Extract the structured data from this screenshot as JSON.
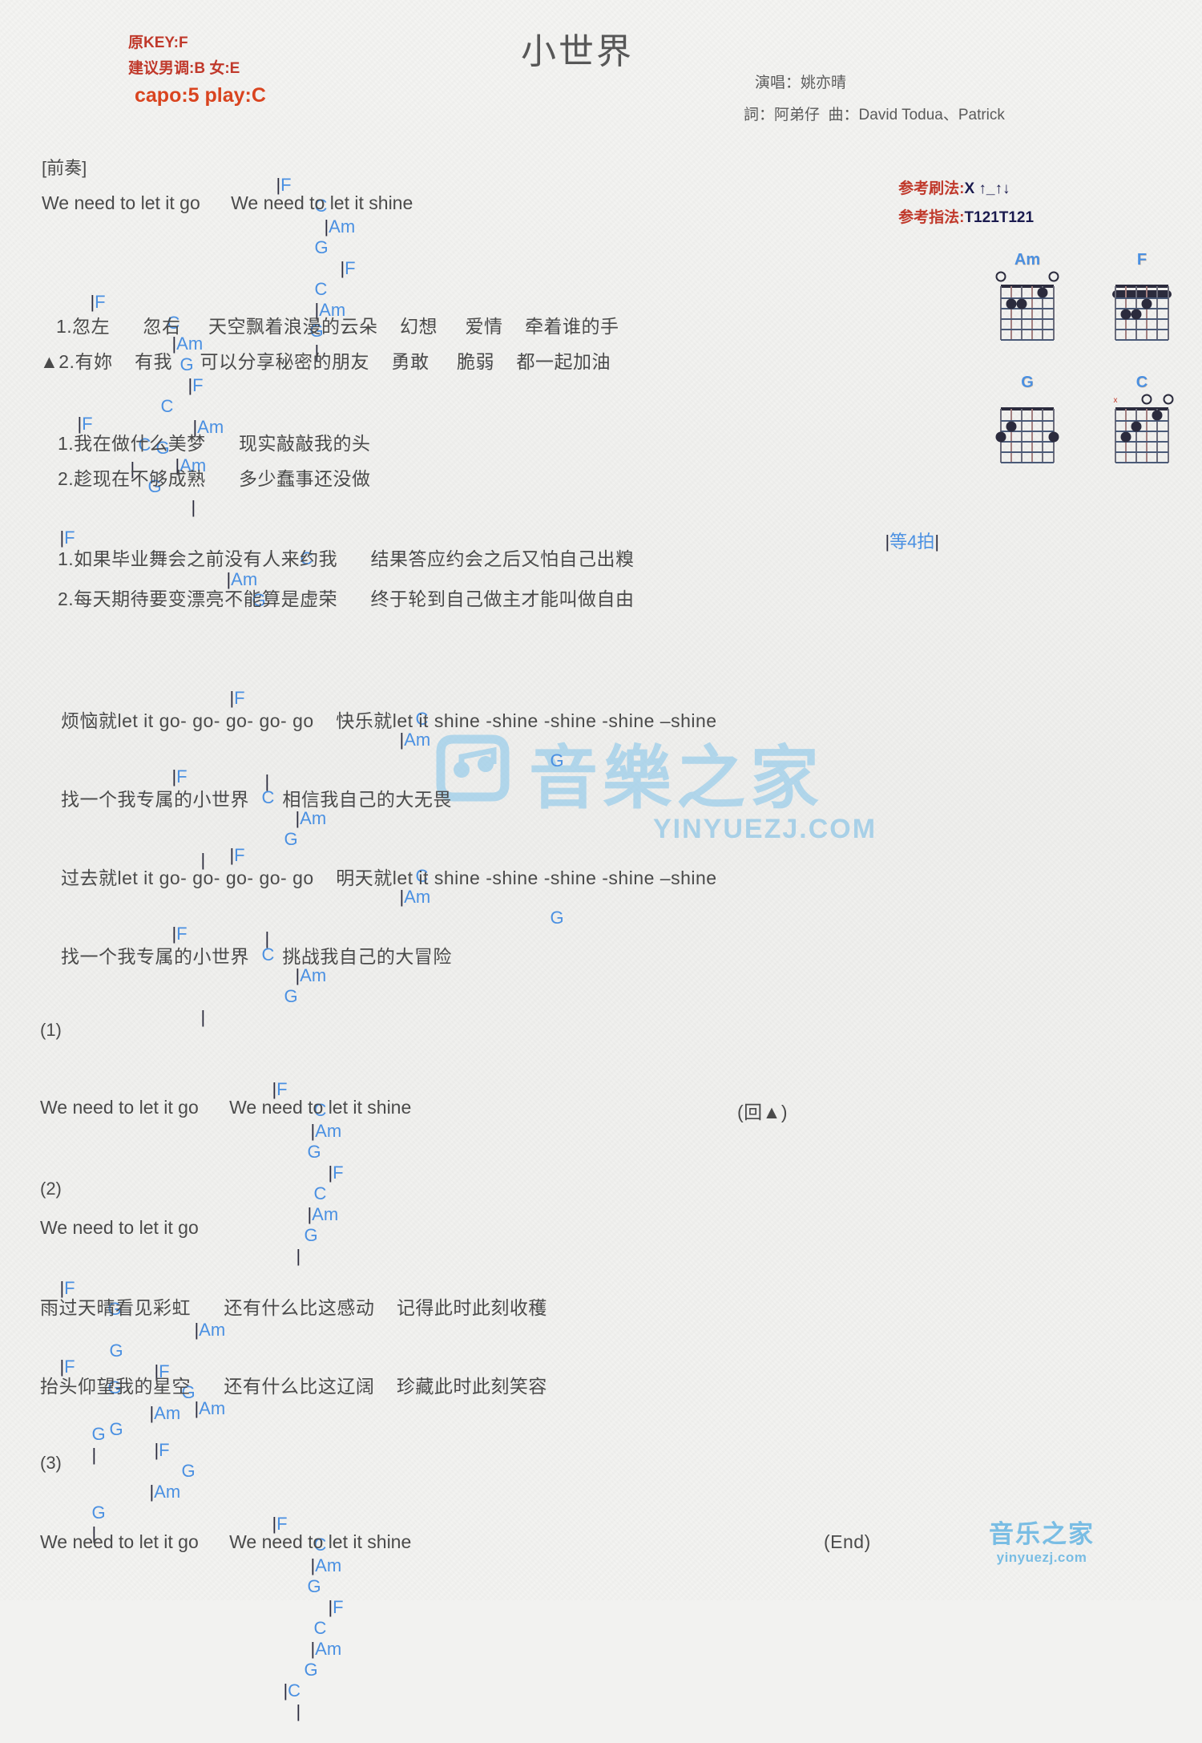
{
  "header": {
    "orig_key": "原KEY:F",
    "suggest_key": "建议男调:B 女:E",
    "capo": "capo:5 play:C",
    "title": "小世界",
    "singer": "演唱：姚亦晴",
    "writers": "詞：阿弟仔  曲：David Todua、Patrick",
    "strum_label": "参考刷法:",
    "strum_value": "X ↑_↑↓",
    "finger_label": "参考指法:",
    "finger_value": "T121T121"
  },
  "chord_diagrams": [
    {
      "name": "Am",
      "markers": [
        "o",
        "",
        "",
        "",
        "",
        "o"
      ],
      "dots": [
        [
          4,
          2
        ],
        [
          3,
          1
        ],
        [
          2,
          1
        ]
      ],
      "barre": null,
      "muted": []
    },
    {
      "name": "F",
      "markers": [
        "",
        "",
        "",
        "",
        "",
        ""
      ],
      "dots": [
        [
          4,
          2
        ],
        [
          3,
          2
        ],
        [
          2,
          1
        ]
      ],
      "barre": 1,
      "muted": []
    },
    {
      "name": "G",
      "markers": [
        "",
        "",
        "",
        "",
        "",
        ""
      ],
      "dots": [
        [
          5,
          2
        ],
        [
          1,
          3
        ],
        [
          6,
          3
        ]
      ],
      "barre": null,
      "muted": []
    },
    {
      "name": "C",
      "markers": [
        "x",
        "",
        "",
        "o",
        "",
        "o"
      ],
      "dots": [
        [
          5,
          3
        ],
        [
          4,
          2
        ],
        [
          2,
          1
        ]
      ],
      "barre": null,
      "muted": [
        "x"
      ]
    }
  ],
  "sections": [
    {
      "id": "intro",
      "label": "[前奏]",
      "chord_line": "|F      C        |Am      G            |F      C     |Am      G     |",
      "lyric_lines": [
        "We need to let it go      We need to let it shine"
      ]
    },
    {
      "id": "verse1",
      "chord_line": "|F         C        |Am           G            |F        C          |Am         G      |",
      "lyric_lines": [
        "1.忽左      忽右     天空飘着浪漫的云朵    幻想     爱情    牵着谁的手",
        "▲2.有妳    有我     可以分享秘密的朋友    勇敢     脆弱    都一起加油"
      ]
    },
    {
      "id": "verse2",
      "chord_line": "|F       C            |Am        G            |",
      "lyric_lines": [
        "1.我在做什么美梦      现实敲敲我的头",
        "2.趁现在不够成熟      多少蠢事还没做"
      ]
    },
    {
      "id": "verse3",
      "chord_line": "|F                           C                      |Am                          G                  |等4拍|",
      "lyric_lines": [
        "1.如果毕业舞会之前没有人来约我      结果答应约会之后又怕自己出糗",
        "2.每天期待要变漂亮不能算是虚荣      终于轮到自己做主才能叫做自由"
      ]
    },
    {
      "id": "chorus1",
      "chord_line": "|F                        C                 |Am                                      G      |",
      "lyric_lines": [
        "烦恼就let it go- go- go- go- go    快乐就let it shine -shine -shine -shine –shine"
      ]
    },
    {
      "id": "chorus2",
      "chord_line": "|F              C            |Am            G      |",
      "lyric_lines": [
        "找一个我专属的小世界      相信我自己的大无畏"
      ]
    },
    {
      "id": "chorus3",
      "chord_line": "|F                        C                 |Am                                      G      |",
      "lyric_lines": [
        "过去就let it go- go- go- go- go    明天就let it shine -shine -shine -shine –shine"
      ]
    },
    {
      "id": "chorus4",
      "chord_line": "|F              C            |Am            G      |",
      "lyric_lines": [
        "找一个我专属的小世界      挑战我自己的大冒险"
      ]
    },
    {
      "id": "part1",
      "label": "(1)",
      "chord_line": "|F      C     |Am     G       |F      C     |Am    G    |",
      "lyric_lines": [
        "We need to let it go      We need to let it shine"
      ],
      "note": "(回▲)"
    },
    {
      "id": "part2",
      "label": "(2)",
      "lyric_lines": [
        "We need to let it go"
      ]
    },
    {
      "id": "part2a",
      "chord_line": "|F      G              |Am       G        |F              G         |Am     G    |",
      "lyric_lines": [
        "雨过天晴看见彩虹      还有什么比这感动    记得此时此刻收穫"
      ]
    },
    {
      "id": "part2b",
      "chord_line": "|F      G              |Am       G        |F              G         |Am     G    |",
      "lyric_lines": [
        "抬头仰望我的星空      还有什么比这辽阔    珍藏此时此刻笑容"
      ]
    },
    {
      "id": "part3",
      "label": "(3)",
      "chord_line": "|F      C     |Am     G       |F      C     |Am    G  |C    |",
      "lyric_lines": [
        "We need to let it go      We need to let it shine"
      ],
      "note": "(End)"
    }
  ],
  "watermark": {
    "center_text": "音樂之家",
    "center_sub": "YINYUEZJ.COM",
    "corner_text": "音乐之家",
    "corner_sub": "yinyuezj.com"
  }
}
